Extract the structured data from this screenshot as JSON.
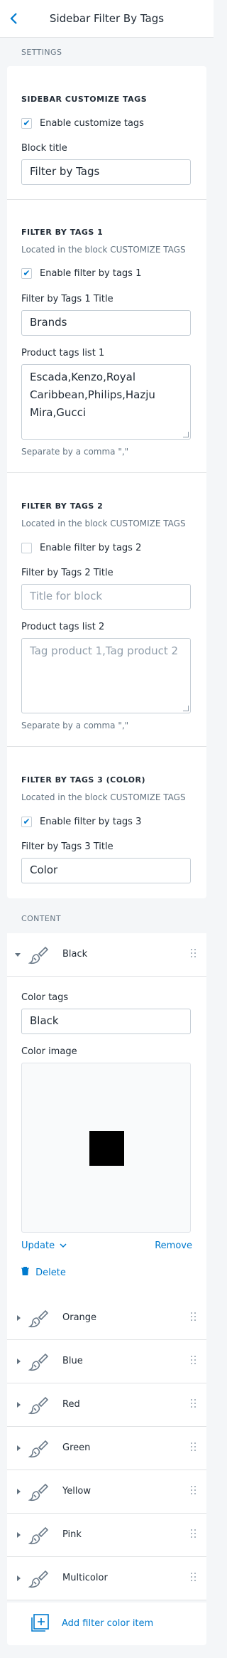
{
  "header": {
    "title": "Sidebar Filter By Tags",
    "back_icon": "chevron-left-icon"
  },
  "settings": {
    "heading": "SETTINGS",
    "customize": {
      "heading": "SIDEBAR CUSTOMIZE TAGS",
      "enable_label": "Enable customize tags",
      "enabled": true,
      "block_title_label": "Block title",
      "block_title_value": "Filter by Tags"
    },
    "tags1": {
      "heading": "FILTER BY TAGS 1",
      "hint": "Located in the block CUSTOMIZE TAGS",
      "enable_label": "Enable filter by tags 1",
      "enabled": true,
      "title_label": "Filter by Tags 1 Title",
      "title_value": "Brands",
      "list_label": "Product tags list 1",
      "list_value": "Escada,Kenzo,Royal Caribbean,Philips,Hazju Mira,Gucci",
      "list_lines": [
        "Escada,Kenzo,Royal",
        "Caribbean,Philips,Hazju",
        "Mira,Gucci"
      ],
      "separator_hint": "Separate by a comma \",\""
    },
    "tags2": {
      "heading": "FILTER BY TAGS 2",
      "hint": "Located in the block CUSTOMIZE TAGS",
      "enable_label": "Enable filter by tags 2",
      "enabled": false,
      "title_label": "Filter by Tags 2 Title",
      "title_placeholder": "Title for block",
      "list_label": "Product tags list 2",
      "list_placeholder": "Tag product 1,Tag product 2",
      "separator_hint": "Separate by a comma \",\""
    },
    "tags3": {
      "heading": "FILTER BY TAGS 3 (COLOR)",
      "hint": "Located in the block CUSTOMIZE TAGS",
      "enable_label": "Enable filter by tags 3",
      "enabled": true,
      "title_label": "Filter by Tags 3 Title",
      "title_value": "Color"
    }
  },
  "content": {
    "heading": "CONTENT",
    "expanded": {
      "name": "Black",
      "color_tags_label": "Color tags",
      "color_tags_value": "Black",
      "color_image_label": "Color image",
      "swatch_color": "#000000",
      "update_label": "Update",
      "remove_label": "Remove",
      "delete_label": "Delete"
    },
    "blocks": [
      {
        "name": "Orange"
      },
      {
        "name": "Blue"
      },
      {
        "name": "Red"
      },
      {
        "name": "Green"
      },
      {
        "name": "Yellow"
      },
      {
        "name": "Pink"
      },
      {
        "name": "Multicolor"
      }
    ],
    "add_label": "Add filter color item"
  },
  "colors": {
    "accent": "#007ace",
    "danger": "#007ace",
    "text": "#212b36",
    "muted": "#637381",
    "border": "#c4cdd5",
    "background": "#f4f6f8"
  }
}
